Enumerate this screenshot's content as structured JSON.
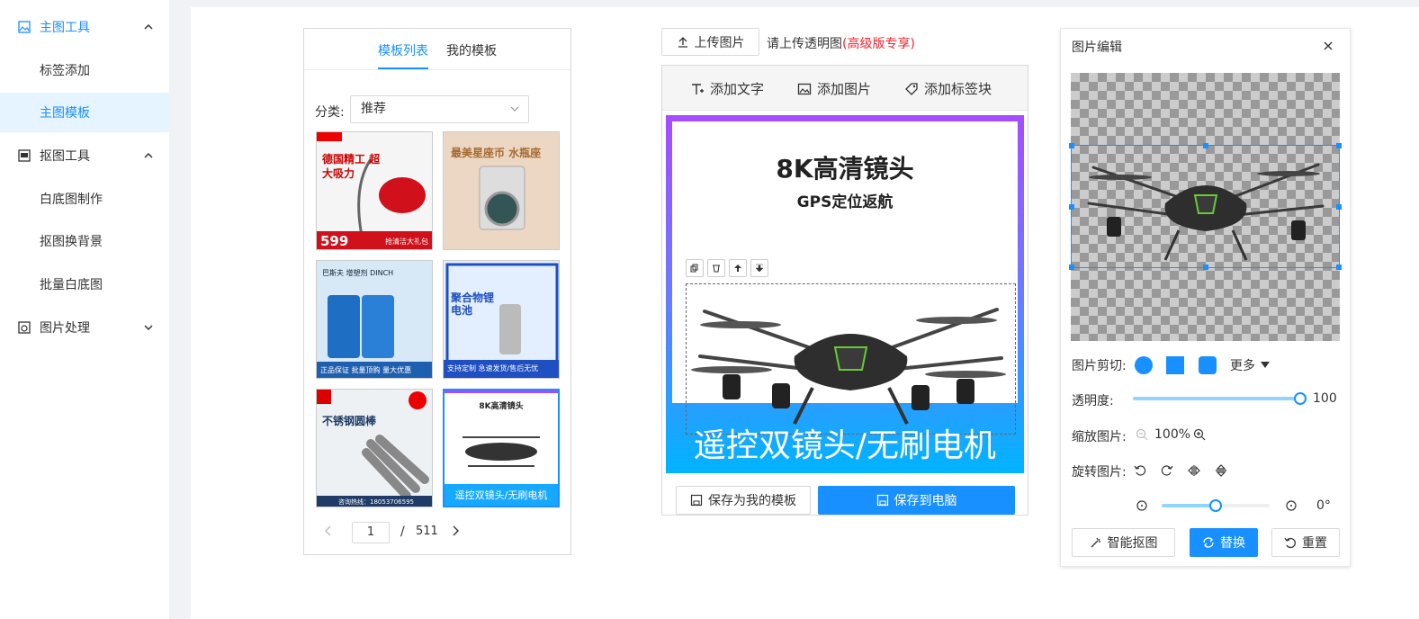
{
  "sidebar": {
    "groups": [
      {
        "label": "主图工具",
        "icon": "image-icon",
        "expanded": true
      },
      {
        "label": "抠图工具",
        "icon": "layers-icon",
        "expanded": true
      },
      {
        "label": "图片处理",
        "icon": "photo-process-icon",
        "expanded": false
      }
    ],
    "items": [
      {
        "label": "标签添加"
      },
      {
        "label": "主图模板",
        "active": true
      },
      {
        "label": "白底图制作"
      },
      {
        "label": "抠图换背景"
      },
      {
        "label": "批量白底图"
      }
    ]
  },
  "templates": {
    "tabs": [
      "模板列表",
      "我的模板"
    ],
    "category_label": "分类:",
    "category_value": "推荐",
    "thumbs": [
      {
        "title": "德国精工 超大吸力",
        "price": "599",
        "tag": "抢清洁大礼包",
        "bg": "#e8e0e0"
      },
      {
        "title": "最美星座币 水瓶座",
        "bg": "#e9d6c7"
      },
      {
        "title": "巴斯夫 增塑剂 DINCH",
        "tag": "正品保证  批量顶购 量大优惠",
        "bg": "#cfe3f5"
      },
      {
        "title": "聚合物锂电池",
        "tag": "支持定制  急速发货/售后无忧",
        "bg": "#dbe9ff"
      },
      {
        "title": "不锈钢圆棒",
        "tag": "咨询热线：18053706595",
        "bg": "#eef1f4"
      },
      {
        "title": "8K高清镜头",
        "tag": "遥控双镜头/无刷电机",
        "bg": "#ffffff"
      }
    ],
    "page": "1",
    "page_sep": "/",
    "total": "511"
  },
  "upload": {
    "button": "上传图片",
    "hint": "请上传透明图",
    "hint_red": "(高级版专享)"
  },
  "canvas": {
    "tools": [
      "添加文字",
      "添加图片",
      "添加标签块"
    ],
    "title": "8K高清镜头",
    "subtitle": "GPS定位返航",
    "bottom": "遥控双镜头/无刷电机",
    "save_template": "保存为我的模板",
    "save_pc": "保存到电脑"
  },
  "editor": {
    "title": "图片编辑",
    "crop_label": "图片剪切:",
    "more": "更多",
    "opacity_label": "透明度:",
    "opacity_value": "100",
    "opacity": 1.0,
    "zoom_label": "缩放图片:",
    "zoom_value": "100%",
    "rotate_label": "旋转图片:",
    "angle_value": "0°",
    "angle_fraction": 0.5,
    "buttons": [
      "智能抠图",
      "替换",
      "重置"
    ],
    "accent": "#1890ff"
  }
}
